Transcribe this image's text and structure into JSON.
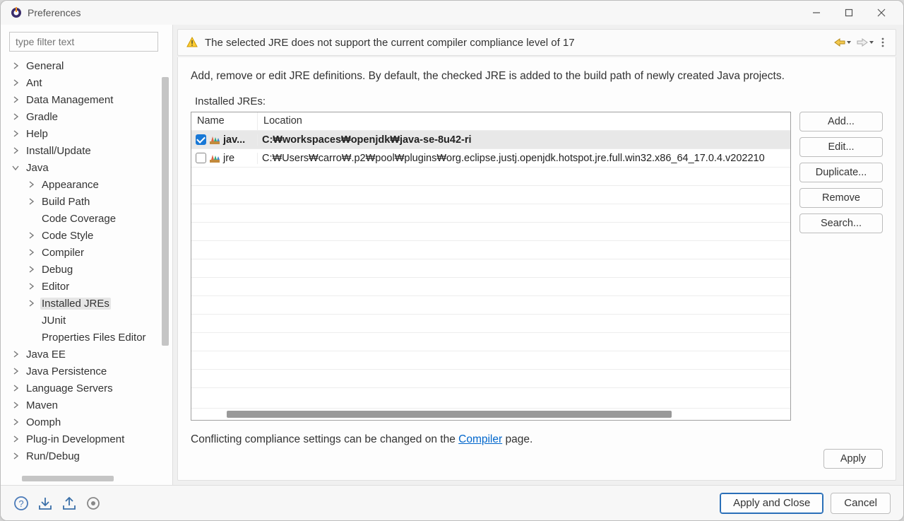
{
  "window": {
    "title": "Preferences"
  },
  "sidebar": {
    "filter_placeholder": "type filter text",
    "items": [
      {
        "label": "General",
        "level": 0,
        "expandable": true
      },
      {
        "label": "Ant",
        "level": 0,
        "expandable": true
      },
      {
        "label": "Data Management",
        "level": 0,
        "expandable": true
      },
      {
        "label": "Gradle",
        "level": 0,
        "expandable": true
      },
      {
        "label": "Help",
        "level": 0,
        "expandable": true
      },
      {
        "label": "Install/Update",
        "level": 0,
        "expandable": true
      },
      {
        "label": "Java",
        "level": 0,
        "expandable": true,
        "expanded": true
      },
      {
        "label": "Appearance",
        "level": 1,
        "expandable": true
      },
      {
        "label": "Build Path",
        "level": 1,
        "expandable": true
      },
      {
        "label": "Code Coverage",
        "level": 1,
        "expandable": false
      },
      {
        "label": "Code Style",
        "level": 1,
        "expandable": true
      },
      {
        "label": "Compiler",
        "level": 1,
        "expandable": true
      },
      {
        "label": "Debug",
        "level": 1,
        "expandable": true
      },
      {
        "label": "Editor",
        "level": 1,
        "expandable": true
      },
      {
        "label": "Installed JREs",
        "level": 1,
        "expandable": true,
        "selected": true
      },
      {
        "label": "JUnit",
        "level": 1,
        "expandable": false
      },
      {
        "label": "Properties Files Editor",
        "level": 1,
        "expandable": false
      },
      {
        "label": "Java EE",
        "level": 0,
        "expandable": true
      },
      {
        "label": "Java Persistence",
        "level": 0,
        "expandable": true
      },
      {
        "label": "Language Servers",
        "level": 0,
        "expandable": true
      },
      {
        "label": "Maven",
        "level": 0,
        "expandable": true
      },
      {
        "label": "Oomph",
        "level": 0,
        "expandable": true
      },
      {
        "label": "Plug-in Development",
        "level": 0,
        "expandable": true
      },
      {
        "label": "Run/Debug",
        "level": 0,
        "expandable": true
      }
    ]
  },
  "banner": {
    "message": "The selected JRE does not support the current compiler compliance level of 17"
  },
  "main": {
    "description": "Add, remove or edit JRE definitions. By default, the checked JRE is added to the build path of newly created Java projects.",
    "section_label": "Installed JREs:",
    "columns": {
      "name": "Name",
      "location": "Location"
    },
    "rows": [
      {
        "checked": true,
        "name": "jav...",
        "location": "C:\\workspaces\\openjdk\\java-se-8u42-ri",
        "selected": true
      },
      {
        "checked": false,
        "name": "jre",
        "location": "C:\\Users\\carro\\.p2\\pool\\plugins\\org.eclipse.justj.openjdk.hotspot.jre.full.win32.x86_64_17.0.4.v202210",
        "selected": false
      }
    ],
    "buttons": {
      "add": "Add...",
      "edit": "Edit...",
      "duplicate": "Duplicate...",
      "remove": "Remove",
      "search": "Search..."
    },
    "conflict_prefix": "Conflicting compliance settings can be changed on the ",
    "conflict_link": "Compiler",
    "conflict_suffix": " page.",
    "apply": "Apply"
  },
  "footer": {
    "apply_close": "Apply and Close",
    "cancel": "Cancel"
  }
}
